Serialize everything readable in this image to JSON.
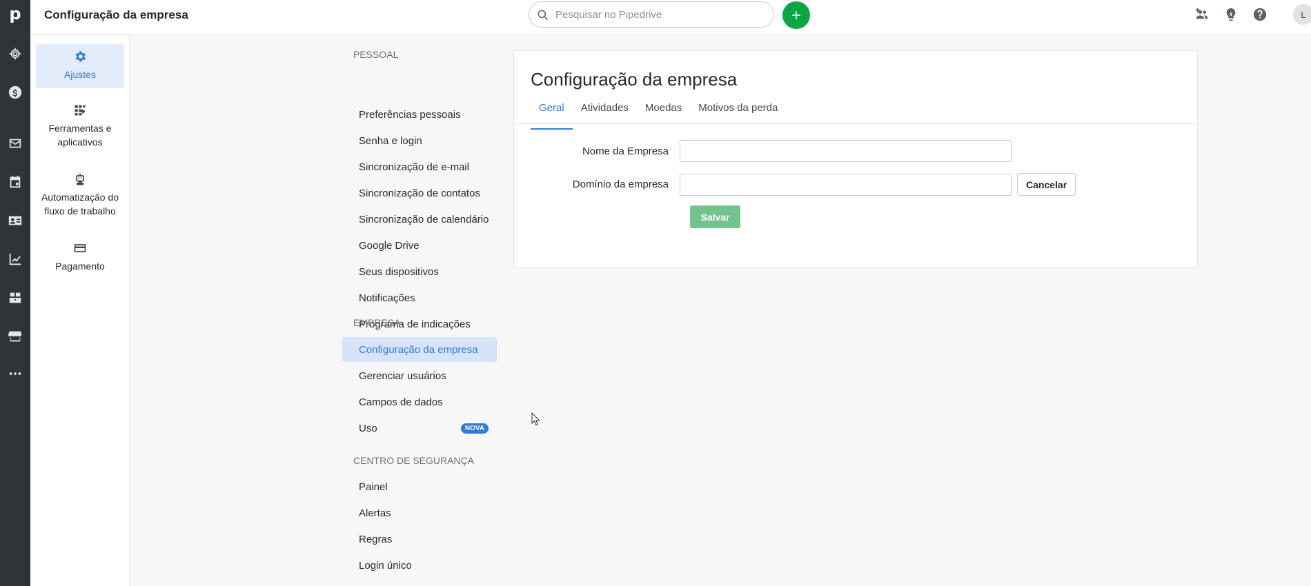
{
  "app": {
    "logo": "p",
    "page_title": "Configuração da empresa"
  },
  "rail": {
    "items": [
      {
        "icon": "target-icon",
        "label": "Leads"
      },
      {
        "icon": "dollar-icon",
        "label": "Deals"
      },
      {
        "icon": "mail-icon",
        "label": "Mail"
      },
      {
        "icon": "calendar-icon",
        "label": "Activities"
      },
      {
        "icon": "contacts-icon",
        "label": "Contacts"
      },
      {
        "icon": "chart-icon",
        "label": "Insights"
      },
      {
        "icon": "products-icon",
        "label": "Products"
      },
      {
        "icon": "marketplace-icon",
        "label": "Marketplace"
      },
      {
        "icon": "more-icon",
        "label": "More"
      }
    ]
  },
  "topbar": {
    "search_placeholder": "Pesquisar no Pipedrive",
    "avatar_initial": "L"
  },
  "categories": [
    {
      "label": "Ajustes",
      "active": true
    },
    {
      "label": "Ferramentas e aplicativos",
      "active": false
    },
    {
      "label": "Automatização do fluxo de trabalho",
      "active": false
    },
    {
      "label": "Pagamento",
      "active": false
    }
  ],
  "nav": {
    "sections": [
      {
        "header": "PESSOAL",
        "items": [
          "Preferências pessoais",
          "Senha e login",
          "Sincronização de e-mail",
          "Sincronização de contatos",
          "Sincronização de calendário",
          "Google Drive",
          "Seus dispositivos",
          "Notificações",
          "Programa de indicações"
        ]
      },
      {
        "header": "EMPRESA",
        "items": [
          "Configuração da empresa",
          "Gerenciar usuários",
          "Campos de dados",
          "Uso"
        ]
      },
      {
        "header": "CENTRO DE SEGURANÇA",
        "items": [
          "Painel",
          "Alertas",
          "Regras",
          "Login único"
        ]
      }
    ],
    "active_item": "Configuração da empresa",
    "badge": "NOVA"
  },
  "card": {
    "title": "Configuração da empresa",
    "tabs": [
      "Geral",
      "Atividades",
      "Moedas",
      "Motivos da perda"
    ],
    "active_tab": "Geral",
    "fields": {
      "company_name_label": "Nome da Empresa",
      "company_name_value": "",
      "company_domain_label": "Domínio da empresa",
      "company_domain_value": ""
    },
    "cancel_label": "Cancelar",
    "save_label": "Salvar"
  },
  "colors": {
    "rail_bg": "#2f3437",
    "accent_blue": "#317ae2",
    "add_green": "#08a742",
    "save_green_disabled": "#71c48c"
  }
}
